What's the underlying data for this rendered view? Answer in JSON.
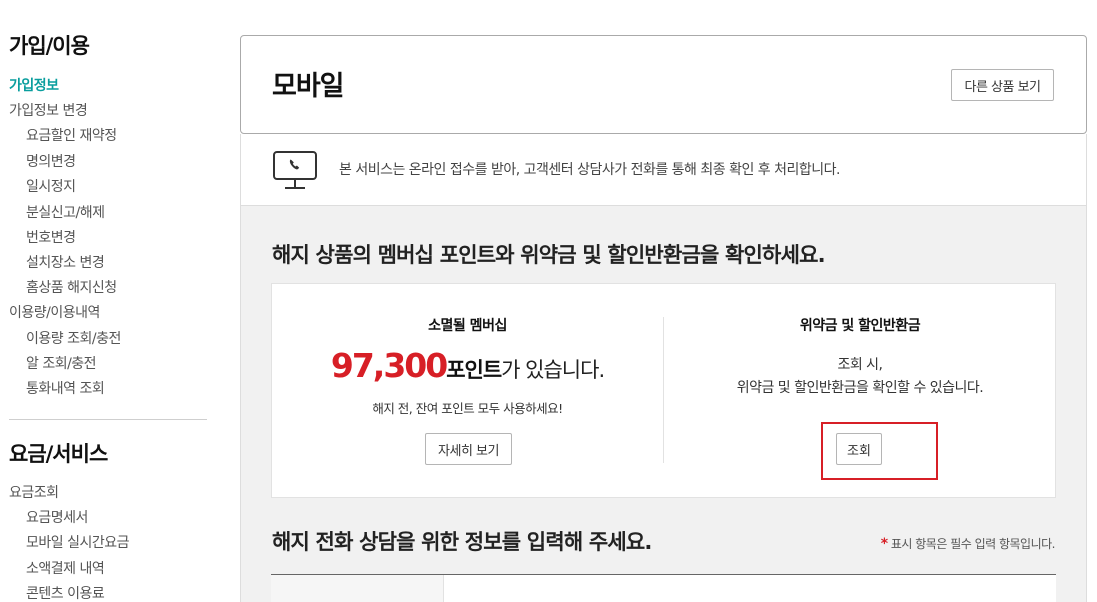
{
  "sidebar": {
    "section1": {
      "heading": "가입/이용",
      "items": [
        {
          "label": "가입정보",
          "level": 1,
          "active": true
        },
        {
          "label": "가입정보 변경",
          "level": 1
        },
        {
          "label": "요금할인 재약정",
          "level": 2
        },
        {
          "label": "명의변경",
          "level": 2
        },
        {
          "label": "일시정지",
          "level": 2
        },
        {
          "label": "분실신고/해제",
          "level": 2
        },
        {
          "label": "번호변경",
          "level": 2
        },
        {
          "label": "설치장소 변경",
          "level": 2
        },
        {
          "label": "홈상품 해지신청",
          "level": 2
        },
        {
          "label": "이용량/이용내역",
          "level": 1
        },
        {
          "label": "이용량 조회/충전",
          "level": 2
        },
        {
          "label": "알 조회/충전",
          "level": 2
        },
        {
          "label": "통화내역 조회",
          "level": 2
        }
      ]
    },
    "section2": {
      "heading": "요금/서비스",
      "items": [
        {
          "label": "요금조회",
          "level": 1
        },
        {
          "label": "요금명세서",
          "level": 2
        },
        {
          "label": "모바일 실시간요금",
          "level": 2
        },
        {
          "label": "소액결제 내역",
          "level": 2
        },
        {
          "label": "콘텐츠 이용료",
          "level": 2
        }
      ]
    }
  },
  "header": {
    "title": "모바일",
    "other_products_label": "다른 상품 보기"
  },
  "notice": {
    "icon": "phone-monitor-icon",
    "text": "본 서비스는 온라인 접수를 받아, 고객센터 상담사가 전화를 통해 최종 확인 후 처리합니다."
  },
  "main": {
    "section1_title": "해지 상품의 멤버십 포인트와 위약금 및 할인반환금을 확인하세요.",
    "membership": {
      "title": "소멸될 멤버십",
      "points_value": "97,300",
      "points_unit": "포인트",
      "points_suffix": "가 있습니다.",
      "note": "해지 전, 잔여 포인트 모두 사용하세요!",
      "detail_button": "자세히 보기"
    },
    "penalty": {
      "title": "위약금 및 할인반환금",
      "line1": "조회 시,",
      "line2": "위약금 및 할인반환금을 확인할 수 있습니다.",
      "lookup_button": "조회"
    },
    "section2_title": "해지 전화 상담을 위한 정보를 입력해 주세요.",
    "required_star": "*",
    "required_note": "표시 항목은 필수 입력 항목입니다."
  },
  "colors": {
    "accent_teal": "#0a9e9e",
    "highlight_red": "#d71f26",
    "background_gray": "#f1f1f1"
  }
}
